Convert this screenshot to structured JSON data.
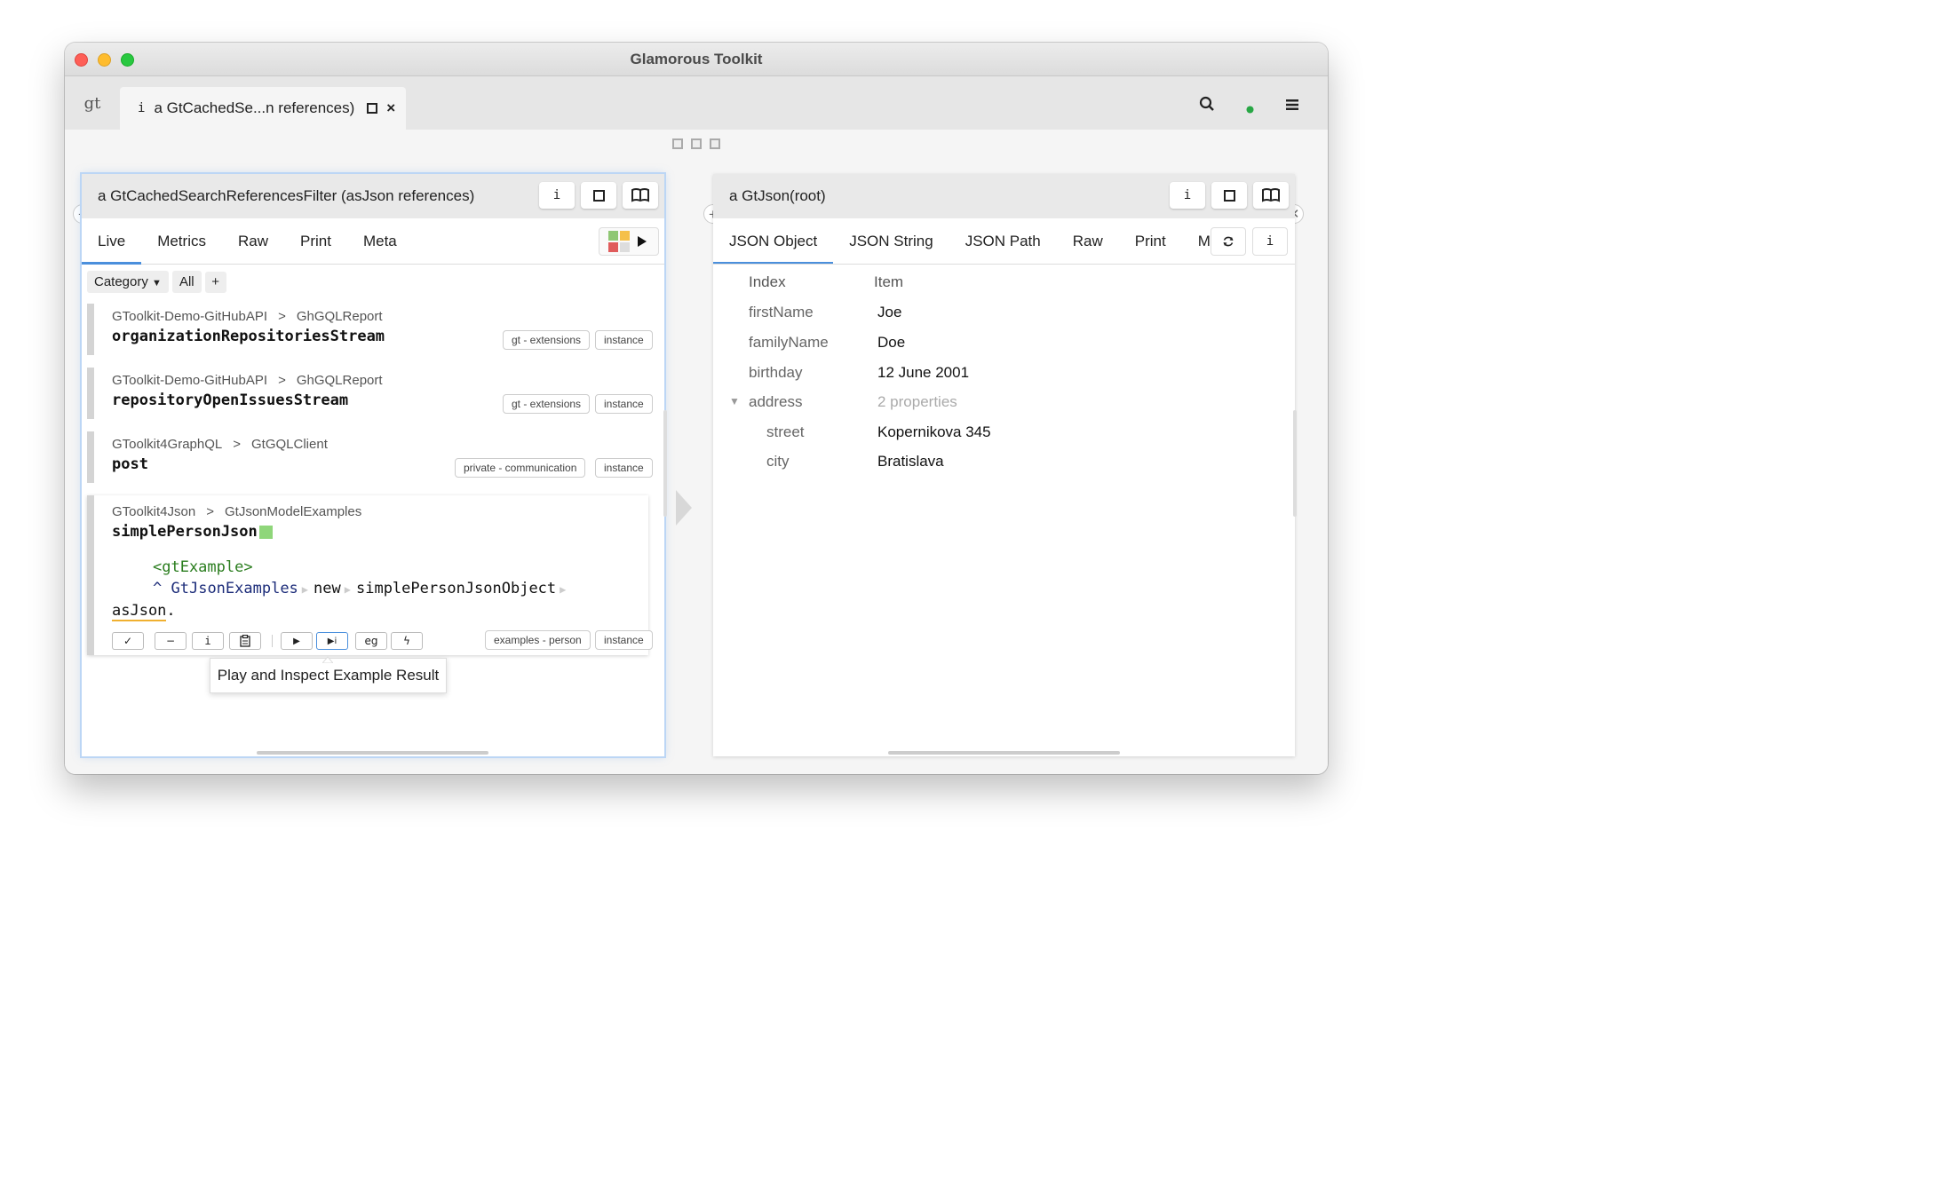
{
  "window": {
    "title": "Glamorous Toolkit"
  },
  "tabbar": {
    "home_label": "gt",
    "tab_icon": "i",
    "tab_label": "a GtCachedSe...n references)",
    "close_label": "×"
  },
  "left_pane": {
    "title": "a GtCachedSearchReferencesFilter (asJson references)",
    "header_buttons": {
      "inspect": "i"
    },
    "tabs": [
      "Live",
      "Metrics",
      "Raw",
      "Print",
      "Meta"
    ],
    "filter": {
      "category": "Category",
      "all": "All",
      "add": "+"
    },
    "items": [
      {
        "package": "GToolkit-Demo-GitHubAPI",
        "sep": ">",
        "class": "GhGQLReport",
        "method": "organizationRepositoriesStream",
        "tags": [
          "gt - extensions",
          "instance"
        ]
      },
      {
        "package": "GToolkit-Demo-GitHubAPI",
        "sep": ">",
        "class": "GhGQLReport",
        "method": "repositoryOpenIssuesStream",
        "tags": [
          "gt - extensions",
          "instance"
        ]
      },
      {
        "package": "GToolkit4GraphQL",
        "sep": ">",
        "class": "GtGQLClient",
        "method": "post",
        "tags": [
          "private - communication",
          "instance"
        ]
      }
    ],
    "expanded": {
      "package": "GToolkit4Json",
      "sep": ">",
      "class": "GtJsonModelExamples",
      "method": "simplePersonJson",
      "pragma": "<gtExample>",
      "caret": "^",
      "receiver": "GtJsonExamples",
      "msg1": "new",
      "msg2": "simplePersonJsonObject",
      "msg3": "asJson",
      "period": ".",
      "tags": [
        "examples - person",
        "instance"
      ],
      "actions": {
        "check": "✓",
        "minus": "−",
        "info": "i",
        "play": "▶",
        "play_inspect": "▶i",
        "eg": "eg",
        "bolt": "ϟ"
      }
    },
    "tooltip": "Play and Inspect Example Result"
  },
  "right_pane": {
    "title": "a GtJson(root)",
    "header_buttons": {
      "inspect": "i"
    },
    "tabs": [
      "JSON Object",
      "JSON String",
      "JSON Path",
      "Raw",
      "Print",
      "Me"
    ],
    "columns": {
      "index": "Index",
      "item": "Item"
    },
    "rows": [
      {
        "key": "firstName",
        "value": "Joe"
      },
      {
        "key": "familyName",
        "value": "Doe"
      },
      {
        "key": "birthday",
        "value": "12 June 2001"
      },
      {
        "key": "address",
        "value": "2 properties"
      },
      {
        "key": "street",
        "value": "Kopernikova 345"
      },
      {
        "key": "city",
        "value": "Bratislava"
      }
    ],
    "extra_buttons": {
      "inspect": "i"
    }
  },
  "icons": [
    "search-icon",
    "status-dot-icon",
    "menu-icon",
    "add-pane-icon",
    "close-pane-icon",
    "maximize-icon",
    "book-icon",
    "refresh-icon",
    "play-icon"
  ],
  "colors": {
    "accent": "#4a8fdc",
    "pragma": "#2a7d1e",
    "class_ref": "#1d2d7a",
    "status_dot": "#28a745"
  }
}
